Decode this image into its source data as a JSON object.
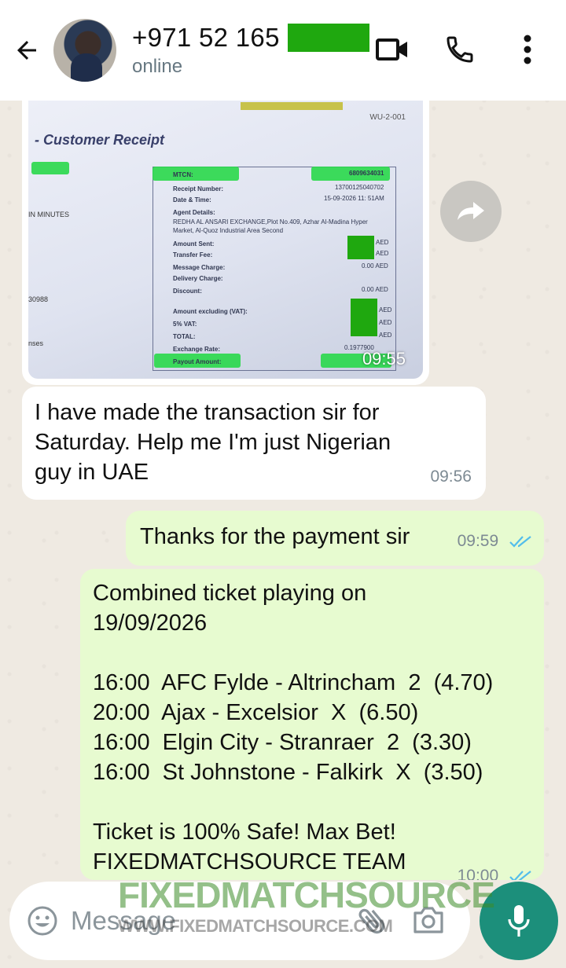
{
  "header": {
    "contact_name": "+971 52 165",
    "status": "online",
    "icons": [
      "back-arrow-icon",
      "video-call-icon",
      "voice-call-icon",
      "more-vert-icon"
    ]
  },
  "receipt_image": {
    "code": "WU-2-001",
    "title": "- Customer Receipt",
    "left_labels": [
      "IN MINUTES",
      "30988",
      "nses"
    ],
    "rows": [
      {
        "label": "MTCN:",
        "value": "6809634031"
      },
      {
        "label": "Receipt Number:",
        "value": "13700125040702"
      },
      {
        "label": "Date & Time:",
        "value": "15-09-2026 11: 51AM"
      },
      {
        "label": "Agent Details:",
        "value": ""
      },
      {
        "label": "REDHA AL ANSARI EXCHANGE,Plot No.409, Azhar Al-Madina Hyper",
        "value": ""
      },
      {
        "label": "Market, Al-Quoz Industrial Area Second",
        "value": ""
      },
      {
        "label": "Amount Sent:",
        "value": "AED"
      },
      {
        "label": "Transfer Fee:",
        "value": "AED"
      },
      {
        "label": "Message Charge:",
        "value": "0.00 AED"
      },
      {
        "label": "Delivery Charge:",
        "value": ""
      },
      {
        "label": "Discount:",
        "value": "0.00 AED"
      },
      {
        "label": "Amount excluding (VAT):",
        "value": "AED"
      },
      {
        "label": "5% VAT:",
        "value": "AED"
      },
      {
        "label": "TOTAL:",
        "value": "AED"
      },
      {
        "label": "Exchange Rate:",
        "value": "0.1977900"
      },
      {
        "label": "Payout Amount:",
        "value": ""
      }
    ],
    "time": "09:55"
  },
  "messages": [
    {
      "direction": "in",
      "lines": [
        "I have made the transaction sir for",
        "Saturday. Help me I'm just Nigerian",
        "guy in UAE"
      ],
      "time": "09:56"
    },
    {
      "direction": "out",
      "lines": [
        "Thanks for the payment sir"
      ],
      "time": "09:59"
    },
    {
      "direction": "out",
      "lines": [
        "Combined ticket playing on",
        "19/09/2026",
        "",
        "16:00  AFC Fylde - Altrincham  2  (4.70)",
        "20:00  Ajax - Excelsior  X  (6.50)",
        "16:00  Elgin City - Stranraer  2  (3.30)",
        "16:00  St Johnstone - Falkirk  X  (3.50)",
        "",
        "Ticket is 100% Safe! Max Bet!",
        "FIXEDMATCHSOURCE TEAM"
      ],
      "time": "10:00"
    }
  ],
  "input": {
    "placeholder": "Message"
  },
  "watermark": {
    "main": "FIXEDMATCHSOURCE",
    "sub": "WWW.FIXEDMATCHSOURCE.COM"
  },
  "colors": {
    "header_bg": "#ffffff",
    "chat_bg": "#efeae2",
    "incoming_bubble": "#ffffff",
    "outgoing_bubble": "#e7fbd0",
    "read_ticks": "#53bdeb",
    "mic_button": "#1c8f7b",
    "redaction": "#1fa80f"
  }
}
